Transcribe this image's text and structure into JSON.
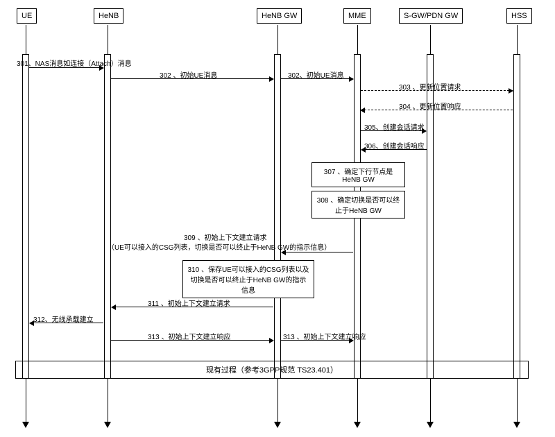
{
  "participants": {
    "ue": "UE",
    "henb": "HeNB",
    "henbgw": "HeNB GW",
    "mme": "MME",
    "sgw": "S-GW/PDN GW",
    "hss": "HSS"
  },
  "messages": {
    "m301": "301、NAS消息如连接（Attach）消息",
    "m302a": "302 、初始UE消息",
    "m302b": "302、初始UE消息",
    "m303": "303 、更新位置请求",
    "m304": "304 、更新位置响应",
    "m305": "305、创建会话请求",
    "m306": "306、创建会话响应",
    "m307": "307 、确定下行节点是HeNB GW",
    "m308": "308 、确定切换是否可以终止于HeNB GW",
    "m309": "309 、初始上下文建立请求",
    "m309sub": "（UE可以接入的CSG列表，切换是否可以终止于HeNB GW的指示信息）",
    "m310": "310 、保存UE可以接入的CSG列表以及切换是否可以终止于HeNB GW的指示信息",
    "m311": "311 、初始上下文建立请求",
    "m312": "312、无线承载建立",
    "m313a": "313 、初始上下文建立响应",
    "m313b": "313 、初始上下文建立响应",
    "final": "现有过程（参考3GPP规范 TS23.401）"
  }
}
